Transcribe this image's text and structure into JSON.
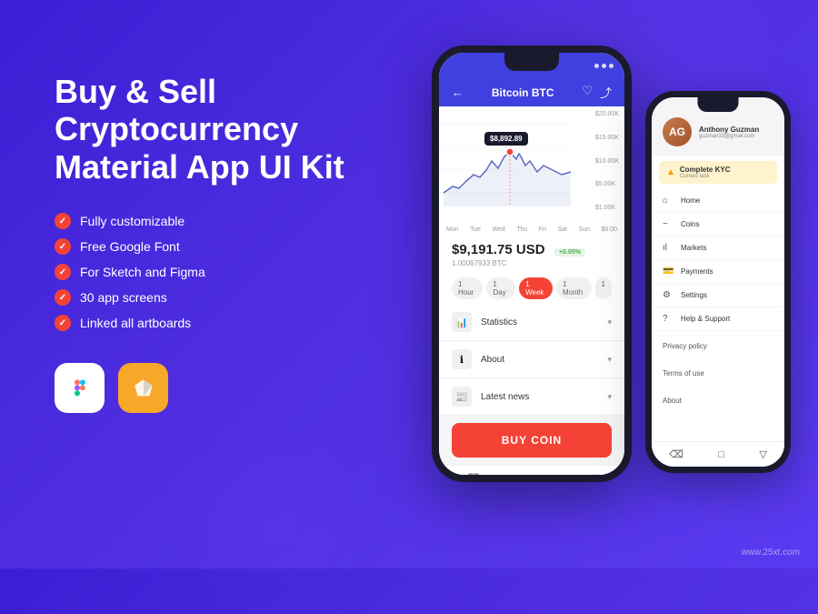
{
  "background": "#4040e0",
  "title": {
    "line1": "Buy & Sell",
    "line2": "Cryptocurrency",
    "line3": "Material App UI Kit"
  },
  "features": [
    "Fully customizable",
    "Free Google Font",
    "For Sketch and Figma",
    "30 app screens",
    "Linked all artboards"
  ],
  "tools": [
    {
      "name": "Figma",
      "label": "F"
    },
    {
      "name": "Sketch",
      "label": "S"
    }
  ],
  "main_phone": {
    "coin": "Bitcoin BTC",
    "price": "$9,191.75 USD",
    "change": "+0.05%",
    "btc_amount": "1.00067933 BTC",
    "price_tooltip": "$8,892.89",
    "chart_y_labels": [
      "$20.00K",
      "$15.00K",
      "$10.00K",
      "$5.00K",
      "$1.00K"
    ],
    "chart_x_labels": [
      "Mon",
      "Tue",
      "Wed",
      "Thu",
      "Fri",
      "Sat",
      "Sun",
      "$0.00"
    ],
    "time_tabs": [
      "1 Hour",
      "1 Day",
      "1 Week",
      "1 Month",
      "1"
    ],
    "active_tab": "1 Week",
    "menu_items": [
      {
        "icon": "📊",
        "label": "Statistics"
      },
      {
        "icon": "ℹ",
        "label": "About"
      },
      {
        "icon": "📰",
        "label": "Latest news"
      }
    ],
    "buy_button": "BUY COIN"
  },
  "secondary_phone": {
    "user_name": "Anthony Guzman",
    "user_email": "guzman33@gmail.com",
    "kyc_title": "Complete KYC",
    "kyc_subtitle": "Current task",
    "nav_items": [
      {
        "icon": "⌂",
        "label": "Home"
      },
      {
        "icon": "◦",
        "label": "Coins"
      },
      {
        "icon": "ıl",
        "label": "Markets"
      },
      {
        "icon": "💳",
        "label": "Payments"
      },
      {
        "icon": "⚙",
        "label": "Settings"
      },
      {
        "icon": "?",
        "label": "Help & Support"
      }
    ],
    "text_items": [
      "Privacy policy",
      "Terms of use",
      "About"
    ]
  },
  "watermark": "www.25xt.com"
}
